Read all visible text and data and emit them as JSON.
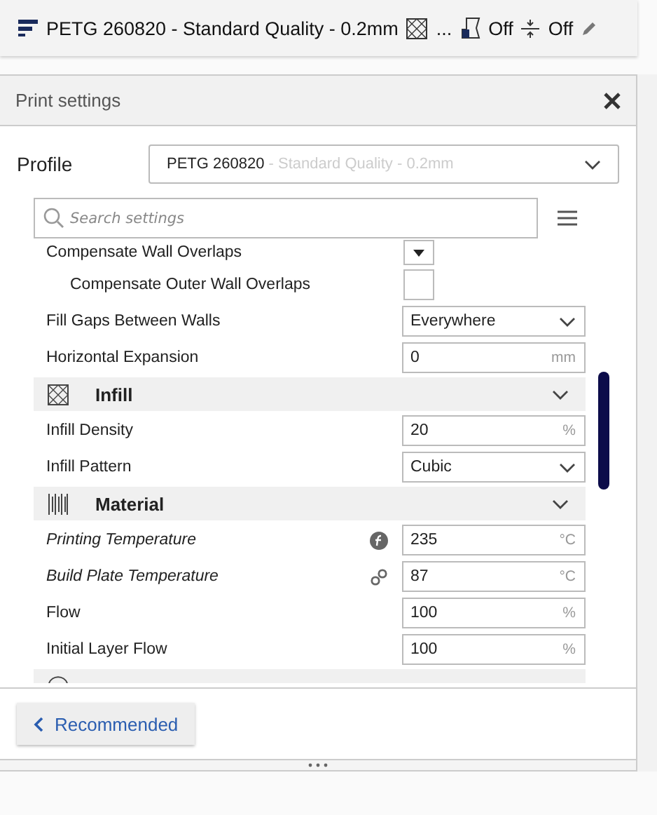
{
  "top_bar": {
    "profile": "PETG 260820 - Standard Quality - 0.2mm",
    "infill": "...",
    "support": "Off",
    "adhesion": "Off"
  },
  "panel": {
    "title": "Print settings"
  },
  "profile": {
    "label": "Profile",
    "name": "PETG 260820",
    "detail": " - Standard Quality - 0.2mm"
  },
  "search": {
    "placeholder": "Search settings"
  },
  "settings": [
    {
      "kind": "checkbox",
      "label": "Compensate Wall Overlaps",
      "checked": true,
      "indented": false
    },
    {
      "kind": "checkbox",
      "label": "Compensate Outer Wall Overlaps",
      "checked": false,
      "indented": true
    },
    {
      "kind": "select",
      "label": "Fill Gaps Between Walls",
      "value": "Everywhere"
    },
    {
      "kind": "number",
      "label": "Horizontal Expansion",
      "value": "0",
      "unit": "mm",
      "italic": false
    },
    {
      "kind": "section",
      "label": "Infill"
    },
    {
      "kind": "number",
      "label": "Infill Density",
      "value": "20",
      "unit": "%",
      "italic": false
    },
    {
      "kind": "select",
      "label": "Infill Pattern",
      "value": "Cubic"
    },
    {
      "kind": "section",
      "label": "Material"
    },
    {
      "kind": "number",
      "label": "Printing Temperature",
      "value": "235",
      "unit": "°C",
      "italic": true,
      "formula": true,
      "linked": false
    },
    {
      "kind": "number",
      "label": "Build Plate Temperature",
      "value": "87",
      "unit": "°C",
      "italic": true,
      "formula": false,
      "linked": true
    },
    {
      "kind": "number",
      "label": "Flow",
      "value": "100",
      "unit": "%",
      "italic": false
    },
    {
      "kind": "number",
      "label": "Initial Layer Flow",
      "value": "100",
      "unit": "%",
      "italic": false
    },
    {
      "kind": "section"
    }
  ],
  "footer": {
    "button": "Recommended"
  }
}
